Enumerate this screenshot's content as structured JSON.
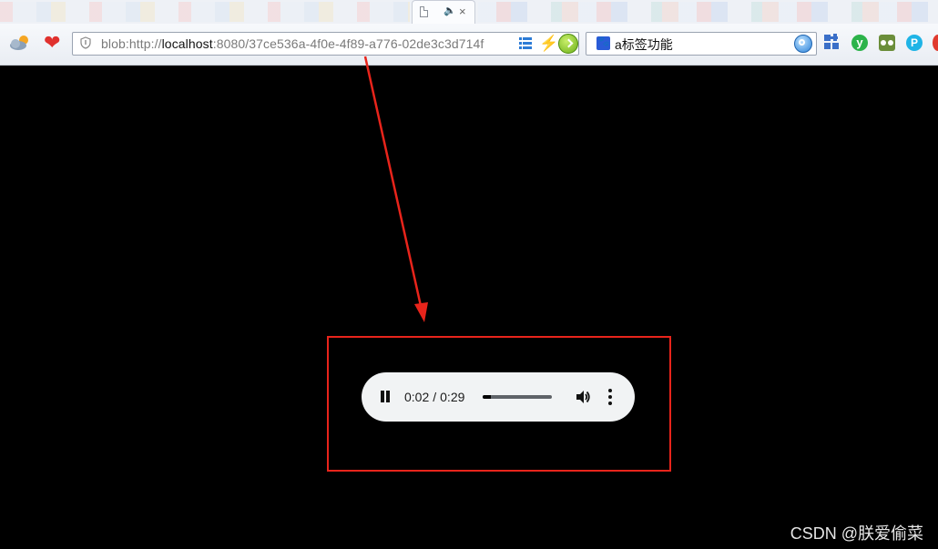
{
  "browser": {
    "tab": {
      "audio_indicator": "🔈",
      "close": "×"
    },
    "address_bar": {
      "url_prefix": "blob:http://",
      "url_host": "localhost",
      "url_rest": ":8080/37ce536a-4f0e-4f89-a776-02de3c3d714f"
    },
    "search_bar": {
      "value": "a标签功能"
    },
    "extensions": {
      "y_label": "y",
      "p_label": "P"
    }
  },
  "audio_player": {
    "current_time": "0:02",
    "separator": "/",
    "duration": "0:29",
    "progress_fraction": 0.12
  },
  "watermark": "CSDN @朕爱偷菜",
  "colors": {
    "annotation": "#e8241b",
    "player_bg": "#f1f3f4",
    "page_bg": "#000000"
  }
}
